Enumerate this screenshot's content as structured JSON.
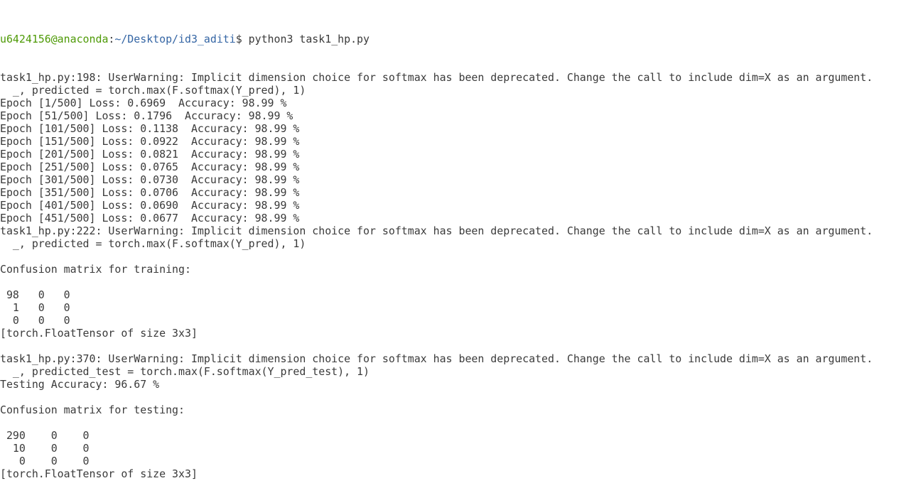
{
  "prompt": {
    "user_host": "u6424156@anaconda",
    "sep": ":",
    "path": "~/Desktop/id3_aditi",
    "symbol": "$ ",
    "command": "python3 task1_hp.py"
  },
  "output_lines": [
    "task1_hp.py:198: UserWarning: Implicit dimension choice for softmax has been deprecated. Change the call to include dim=X as an argument.",
    "  _, predicted = torch.max(F.softmax(Y_pred), 1)",
    "Epoch [1/500] Loss: 0.6969  Accuracy: 98.99 %",
    "Epoch [51/500] Loss: 0.1796  Accuracy: 98.99 %",
    "Epoch [101/500] Loss: 0.1138  Accuracy: 98.99 %",
    "Epoch [151/500] Loss: 0.0922  Accuracy: 98.99 %",
    "Epoch [201/500] Loss: 0.0821  Accuracy: 98.99 %",
    "Epoch [251/500] Loss: 0.0765  Accuracy: 98.99 %",
    "Epoch [301/500] Loss: 0.0730  Accuracy: 98.99 %",
    "Epoch [351/500] Loss: 0.0706  Accuracy: 98.99 %",
    "Epoch [401/500] Loss: 0.0690  Accuracy: 98.99 %",
    "Epoch [451/500] Loss: 0.0677  Accuracy: 98.99 %",
    "task1_hp.py:222: UserWarning: Implicit dimension choice for softmax has been deprecated. Change the call to include dim=X as an argument.",
    "  _, predicted = torch.max(F.softmax(Y_pred), 1)",
    "",
    "Confusion matrix for training:",
    "",
    " 98   0   0",
    "  1   0   0",
    "  0   0   0",
    "[torch.FloatTensor of size 3x3]",
    "",
    "task1_hp.py:370: UserWarning: Implicit dimension choice for softmax has been deprecated. Change the call to include dim=X as an argument.",
    "  _, predicted_test = torch.max(F.softmax(Y_pred_test), 1)",
    "Testing Accuracy: 96.67 %",
    "",
    "Confusion matrix for testing:",
    "",
    " 290    0    0",
    "  10    0    0",
    "   0    0    0",
    "[torch.FloatTensor of size 3x3]"
  ],
  "colors": {
    "background": "#ffffff",
    "text": "#3a3a3a",
    "user_host": "#4e9a06",
    "path": "#3465a4"
  }
}
